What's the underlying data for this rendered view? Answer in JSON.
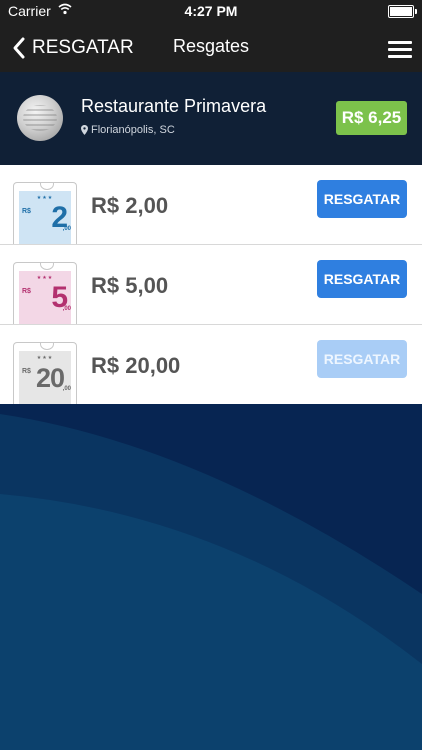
{
  "status_bar": {
    "carrier": "Carrier",
    "time": "4:27 PM"
  },
  "nav": {
    "back_label": "RESGATAR",
    "title": "Resgates"
  },
  "restaurant": {
    "name": "Restaurante Primavera",
    "location": "Florianópolis, SC",
    "balance": "R$ 6,25"
  },
  "vouchers": [
    {
      "amount": "R$ 2,00",
      "ticket_rs": "R$",
      "ticket_value": "2",
      "ticket_cents": ",00",
      "action": "RESGATAR",
      "enabled": true,
      "color": "#1f6fa8"
    },
    {
      "amount": "R$ 5,00",
      "ticket_rs": "R$",
      "ticket_value": "5",
      "ticket_cents": ",00",
      "action": "RESGATAR",
      "enabled": true,
      "color": "#b3306f"
    },
    {
      "amount": "R$ 20,00",
      "ticket_rs": "R$",
      "ticket_value": "20",
      "ticket_cents": ",00",
      "action": "RESGATAR",
      "enabled": false,
      "color": "#6a6a6a"
    }
  ],
  "colors": {
    "button": "#2f7fe0",
    "button_disabled": "#a9cdf6",
    "balance": "#7cc24b",
    "header": "#102036"
  }
}
